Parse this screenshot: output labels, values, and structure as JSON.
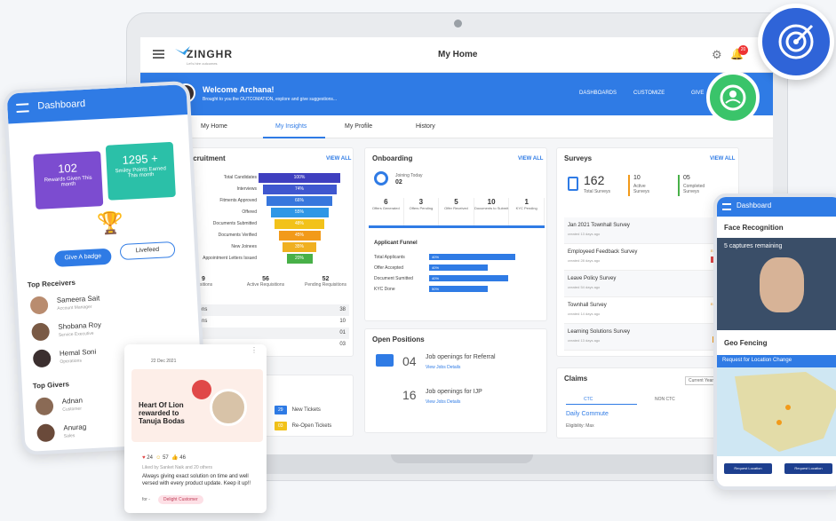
{
  "app": {
    "logo": "ZINGHR",
    "logo_sub": "Let's hire outcomes",
    "title": "My Home",
    "notif_count": "20"
  },
  "welcome": {
    "greeting": "Welcome Archana!",
    "sub": "Brought to you the OUTCOMATION, explore and give suggestions...",
    "links": [
      "DASHBOARDS",
      "CUSTOMIZE",
      "GIVE"
    ]
  },
  "tabs": [
    "My Home",
    "My Insights",
    "My Profile",
    "History"
  ],
  "recruitment": {
    "title": "Recruitment",
    "view_all": "VIEW ALL",
    "stages": [
      {
        "label": "Total Candidates",
        "value": "100%",
        "color": "#3f3fbf"
      },
      {
        "label": "Interviews",
        "value": "74%",
        "color": "#3f57cf"
      },
      {
        "label": "Fitments Approved",
        "value": "66%",
        "color": "#3777dd"
      },
      {
        "label": "Offered",
        "value": "55%",
        "color": "#2f97e6"
      },
      {
        "label": "Documents Submitted",
        "value": "48%",
        "color": "#f2c21a"
      },
      {
        "label": "Documents Verified",
        "value": "45%",
        "color": "#f29a1a"
      },
      {
        "label": "New Joinees",
        "value": "35%",
        "color": "#f0b020"
      },
      {
        "label": "Appointment Letters Issued",
        "value": "20%",
        "color": "#48b048"
      }
    ],
    "stats": [
      {
        "value": "9",
        "label": "Positions"
      },
      {
        "value": "56",
        "label": "Active Requisitions"
      },
      {
        "value": "52",
        "label": "Pending Requisitions"
      }
    ],
    "rows": [
      {
        "label": "Positions",
        "value": "38"
      },
      {
        "label": "Positions",
        "value": "10"
      },
      {
        "label": "",
        "value": "01"
      },
      {
        "label": "",
        "value": "03"
      }
    ]
  },
  "tickets": [
    {
      "count": "29",
      "label": "New Tickets",
      "color": "#2f7be5"
    },
    {
      "count": "03",
      "label": "Re-Open Tickets",
      "color": "#f2c21a"
    }
  ],
  "onboarding": {
    "title": "Onboarding",
    "view_all": "VIEW ALL",
    "joining_label": "Joining Today",
    "joining_value": "02",
    "stats": [
      {
        "value": "6",
        "label": "Offers Generated"
      },
      {
        "value": "3",
        "label": "Offers Pending"
      },
      {
        "value": "5",
        "label": "Offer Received"
      },
      {
        "value": "10",
        "label": "Documents to Submit"
      },
      {
        "value": "1",
        "label": "KYC Pending"
      }
    ],
    "funnel_title": "Applicant Funnel",
    "funnel": [
      {
        "label": "Total Applicants",
        "value": "40%",
        "fill": 0.88
      },
      {
        "label": "Offer Accepted",
        "value": "40%",
        "fill": 0.6
      },
      {
        "label": "Document Sumitted",
        "value": "40%",
        "fill": 0.81
      },
      {
        "label": "KYC Done",
        "value": "50%",
        "fill": 0.6
      }
    ]
  },
  "open_positions": {
    "title": "Open Positions",
    "items": [
      {
        "count": "04",
        "label": "Job openings for Referral",
        "link": "View Jobs Details"
      },
      {
        "count": "16",
        "label": "Job openings for IJP",
        "link": "View Jobs Details"
      }
    ]
  },
  "surveys": {
    "title": "Surveys",
    "view_all": "VIEW ALL",
    "total": "162",
    "total_label": "Total Surveys",
    "active": "10",
    "active_label": "Active Surveys",
    "completed": "05",
    "completed_label": "Completed Surveys",
    "items": [
      {
        "name": "Jan 2021 Townhall Survey",
        "date": "created 13 days ago",
        "status": "Completed",
        "tag": "Voluntary",
        "tag_color": "#7c3cc8"
      },
      {
        "name": "Employeed Feedback Survey",
        "date": "created 28 days ago",
        "status": "Extent Pending",
        "tag": "Anonymous",
        "tag_color": "#e04848"
      },
      {
        "name": "Leave Policy Survey",
        "date": "created 54 days ago",
        "status": "Completed",
        "tag": "Voluntary",
        "tag_color": "#7c3cc8"
      },
      {
        "name": "Townhall Survey",
        "date": "created 14 days ago",
        "status": "Extent Pending",
        "tag": "Regular",
        "tag_color": "#2f7be5"
      },
      {
        "name": "Learning Solutions Survey",
        "date": "created 13 days ago",
        "status": "Completed",
        "tag": "Mandatory",
        "tag_color": "#f29a1a"
      }
    ]
  },
  "claims": {
    "title": "Claims",
    "filter": "Current Year",
    "tabs": [
      "CTC",
      "NON CTC"
    ],
    "item": "Daily Commute",
    "eligibility": "Eligibility: Max"
  },
  "phone_left": {
    "title": "Dashboard",
    "rewards_value": "102",
    "rewards_label": "Rewards Given This month",
    "points_value": "1295 +",
    "points_label": "Smiley Points Earned This month",
    "badge_btn": "Give A badge",
    "livefeed_btn": "Livefeed",
    "receivers_title": "Top Receivers",
    "receivers": [
      {
        "name": "Sameera Sait",
        "role": "Account Manager"
      },
      {
        "name": "Shobana Roy",
        "role": "Service Executive"
      },
      {
        "name": "Hemal Soni",
        "role": "Operations"
      }
    ],
    "givers_title": "Top Givers",
    "givers": [
      {
        "name": "Adnan",
        "role": "Customer"
      },
      {
        "name": "Anurag",
        "role": "Sales"
      }
    ]
  },
  "feed_card": {
    "date": "22 Dec 2021",
    "headline": "Heart Of Lion rewarded to Tanuja Bodas",
    "reactions": [
      "24",
      "57",
      "46"
    ],
    "liked": "Liked by Sanket Naik and 20 others",
    "message": "Always giving exact solution on time and well versed with every product update. Keep it up!!",
    "for_label": "for -",
    "for_tag": "Delight Customer"
  },
  "phone_right": {
    "title": "Dashboard",
    "face_title": "Face Recognition",
    "captures": "5 captures remaining",
    "geo_title": "Geo Fencing",
    "request": "Request for Location Change",
    "btn1": "Request Location",
    "btn2": "Request Location"
  }
}
